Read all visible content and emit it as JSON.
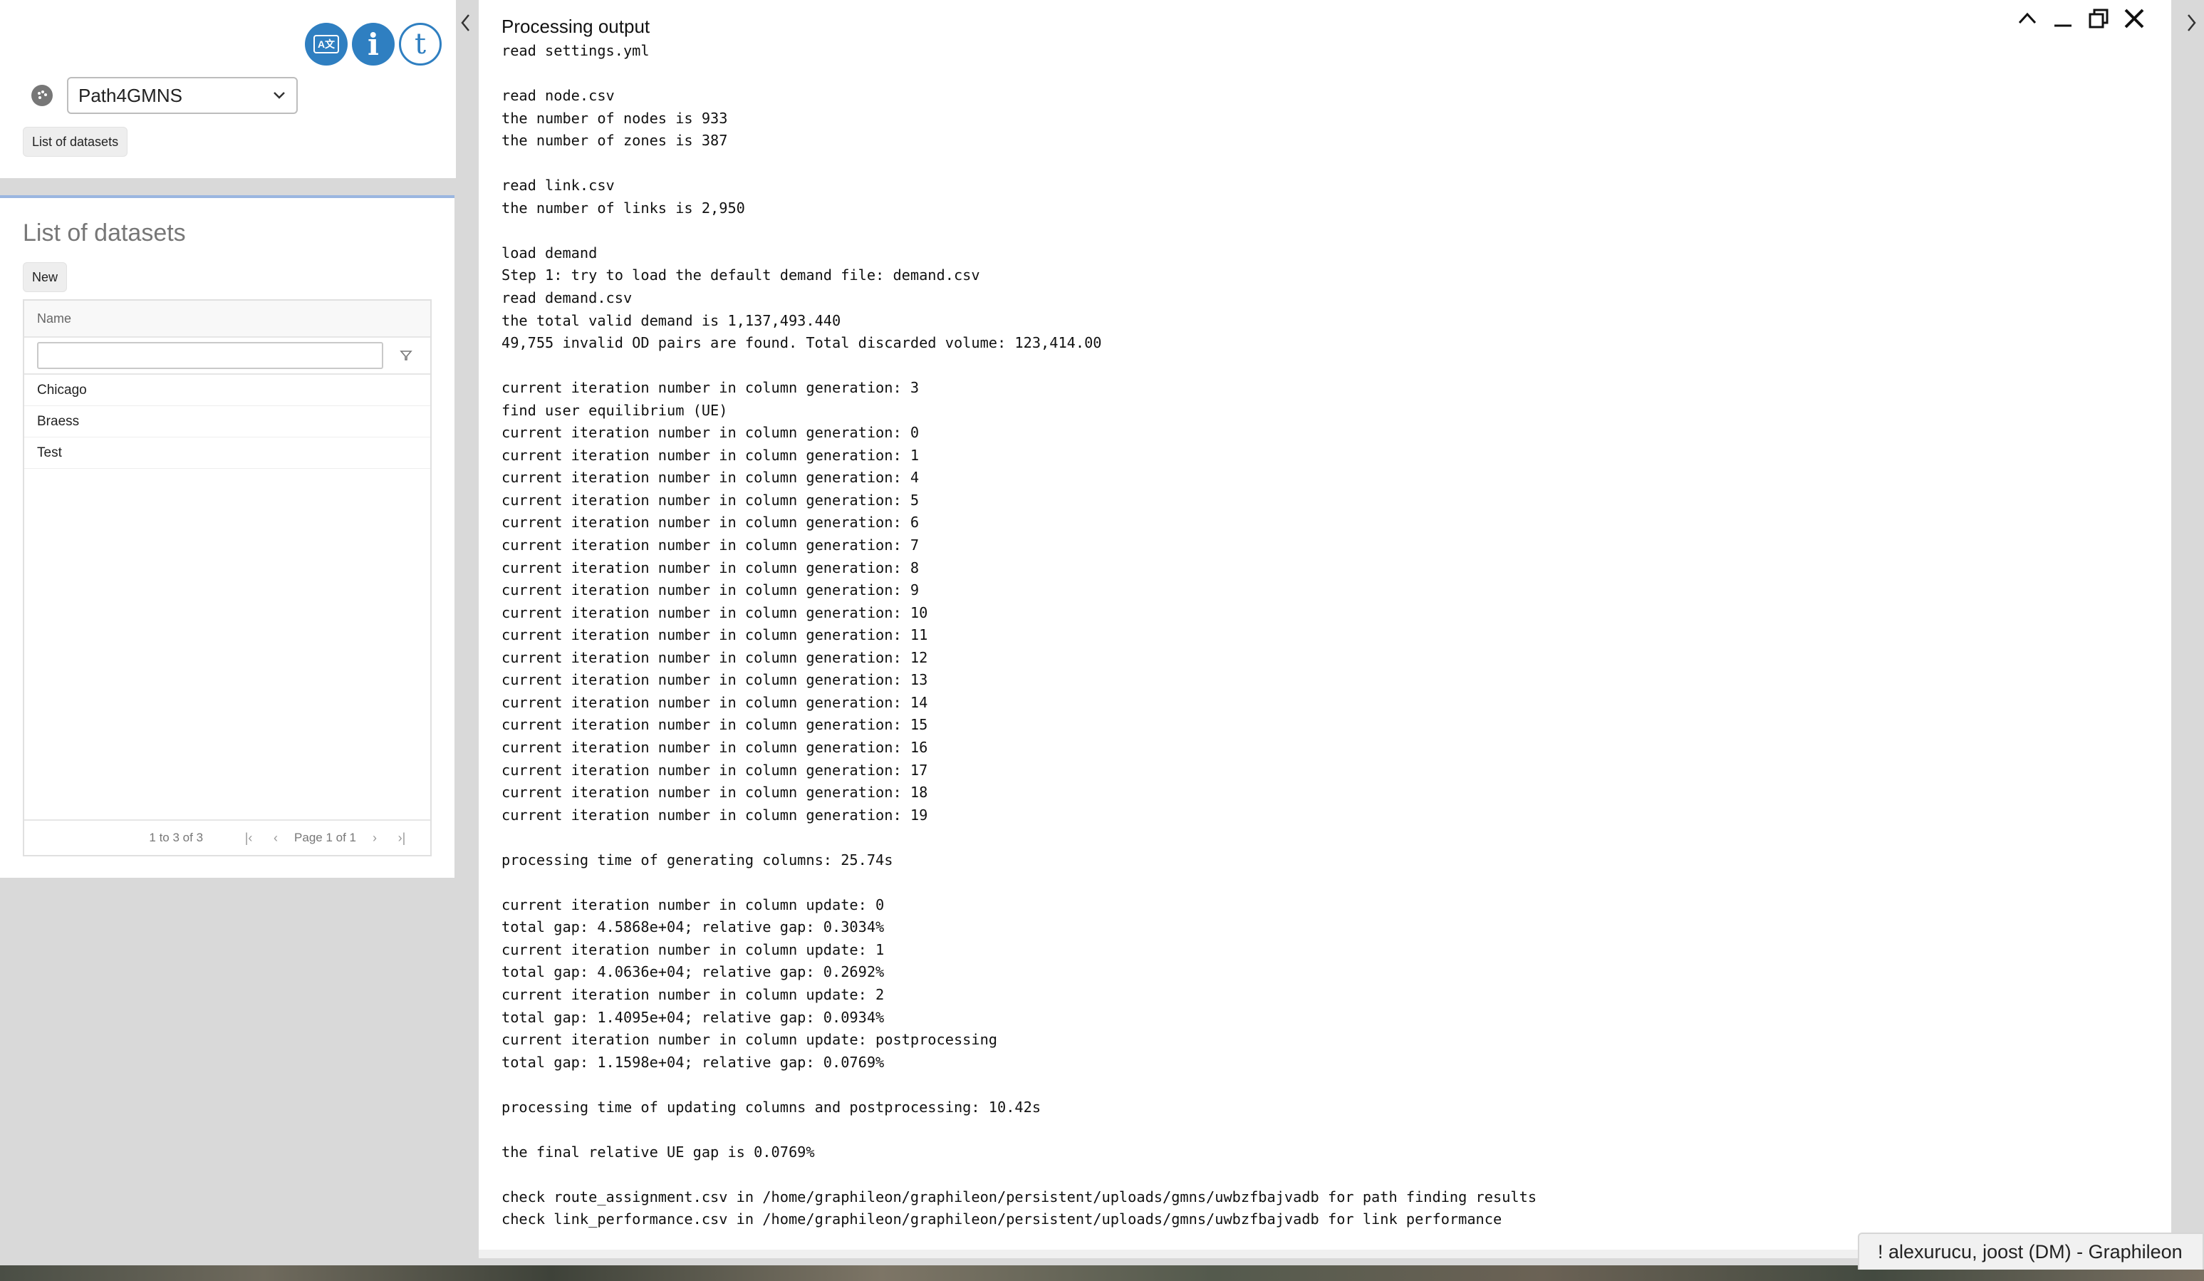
{
  "header": {
    "app_select_value": "Path4GMNS",
    "list_button_label": "List of datasets",
    "icons": [
      "translate-icon",
      "info-icon",
      "t-logo-icon",
      "palette-icon",
      "chevron-down-icon"
    ],
    "t_logo_text": "t",
    "info_glyph": "i",
    "translate_glyph": "A文"
  },
  "datasets": {
    "title": "List of datasets",
    "new_button_label": "New",
    "column_header": "Name",
    "filter_value": "",
    "rows": [
      "Chicago",
      "Braess",
      "Test"
    ],
    "footer": {
      "row_count": "1 to 3 of 3",
      "page_info": "Page 1 of 1"
    }
  },
  "output": {
    "title": "Processing output",
    "lines": [
      "read settings.yml",
      "",
      "read node.csv",
      "the number of nodes is 933",
      "the number of zones is 387",
      "",
      "read link.csv",
      "the number of links is 2,950",
      "",
      "load demand",
      "Step 1: try to load the default demand file: demand.csv",
      "read demand.csv",
      "the total valid demand is 1,137,493.440",
      "49,755 invalid OD pairs are found. Total discarded volume: 123,414.00",
      "",
      "current iteration number in column generation: 3",
      "find user equilibrium (UE)",
      "current iteration number in column generation: 0",
      "current iteration number in column generation: 1",
      "current iteration number in column generation: 4",
      "current iteration number in column generation: 5",
      "current iteration number in column generation: 6",
      "current iteration number in column generation: 7",
      "current iteration number in column generation: 8",
      "current iteration number in column generation: 9",
      "current iteration number in column generation: 10",
      "current iteration number in column generation: 11",
      "current iteration number in column generation: 12",
      "current iteration number in column generation: 13",
      "current iteration number in column generation: 14",
      "current iteration number in column generation: 15",
      "current iteration number in column generation: 16",
      "current iteration number in column generation: 17",
      "current iteration number in column generation: 18",
      "current iteration number in column generation: 19",
      "",
      "processing time of generating columns: 25.74s",
      "",
      "current iteration number in column update: 0",
      "total gap: 4.5868e+04; relative gap: 0.3034%",
      "current iteration number in column update: 1",
      "total gap: 4.0636e+04; relative gap: 0.2692%",
      "current iteration number in column update: 2",
      "total gap: 1.4095e+04; relative gap: 0.0934%",
      "current iteration number in column update: postprocessing",
      "total gap: 1.1598e+04; relative gap: 0.0769%",
      "",
      "processing time of updating columns and postprocessing: 10.42s",
      "",
      "the final relative UE gap is 0.0769%",
      "",
      "check route_assignment.csv in /home/graphileon/graphileon/persistent/uploads/gmns/uwbzfbajvadb for path finding results",
      "check link_performance.csv in /home/graphileon/graphileon/persistent/uploads/gmns/uwbzfbajvadb for link performance"
    ]
  },
  "user_tab": {
    "label": "! alexurucu, joost (DM) - Graphileon"
  },
  "colors": {
    "accent": "#2f7fc1",
    "panel_bg": "#ffffff",
    "desktop_bg": "#d9d9d9"
  }
}
